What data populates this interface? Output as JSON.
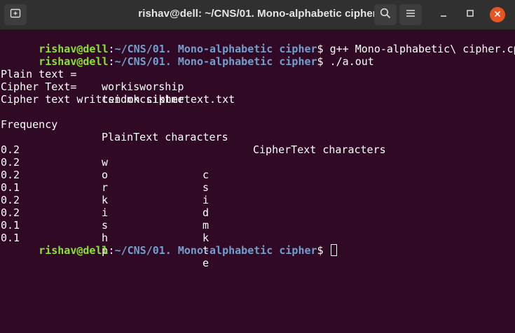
{
  "window": {
    "title": "rishav@dell: ~/CNS/01. Mono-alphabetic cipher",
    "icons": {
      "new_tab": "new-tab-icon",
      "search": "search-icon",
      "menu": "hamburger-menu-icon",
      "minimize": "minimize-icon",
      "maximize": "maximize-icon",
      "close": "close-icon"
    },
    "close_color": "#e95420"
  },
  "prompt": {
    "user_host": "rishav@dell",
    "colon": ":",
    "path": "~/CNS/01. Mono-alphabetic cipher",
    "dollar": "$"
  },
  "commands": [
    " g++ Mono-alphabetic\\ cipher.cpp",
    " ./a.out"
  ],
  "output": {
    "plain_label": "Plain text =",
    "plain_value": "workisworship",
    "cipher_label": "Cipher Text=",
    "cipher_value": "csidmkcsiktme",
    "written_msg": "Cipher text written on ciphertext.txt",
    "headers": {
      "frequency": "Frequency",
      "plain": "PlainText characters",
      "cipher": "CipherText characters"
    },
    "rows": [
      {
        "freq": "0.2",
        "plain": "w",
        "cipher": "c"
      },
      {
        "freq": "0.2",
        "plain": "o",
        "cipher": "s"
      },
      {
        "freq": "0.2",
        "plain": "r",
        "cipher": "i"
      },
      {
        "freq": "0.1",
        "plain": "k",
        "cipher": "d"
      },
      {
        "freq": "0.2",
        "plain": "i",
        "cipher": "m"
      },
      {
        "freq": "0.2",
        "plain": "s",
        "cipher": "k"
      },
      {
        "freq": "0.1",
        "plain": "h",
        "cipher": "t"
      },
      {
        "freq": "0.1",
        "plain": "p",
        "cipher": "e"
      }
    ]
  },
  "colors": {
    "terminal_bg": "#300a24",
    "prompt_user": "#8ae234",
    "prompt_path": "#729fcf",
    "titlebar_bg": "#303030"
  }
}
